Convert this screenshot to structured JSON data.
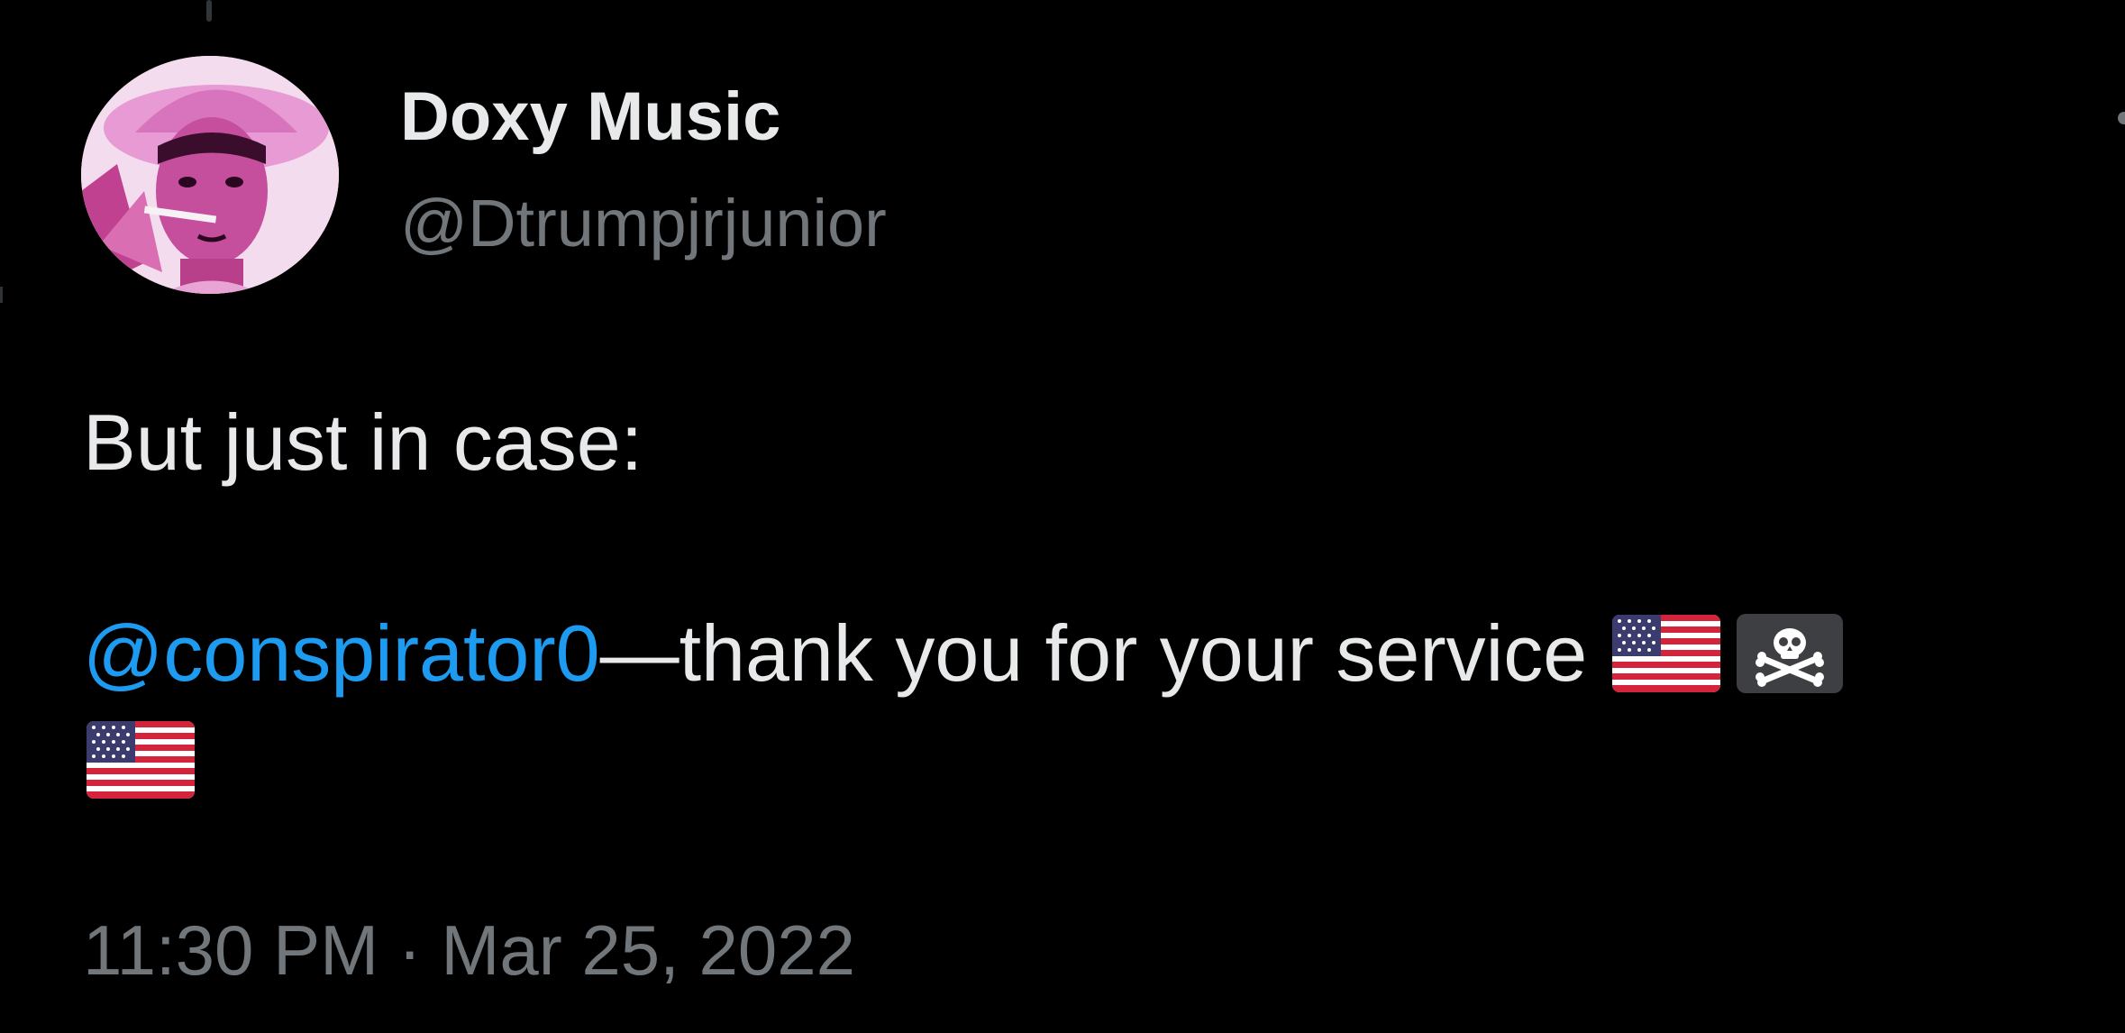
{
  "author": {
    "display_name": "Doxy Music",
    "handle": "@Dtrumpjrjunior"
  },
  "tweet": {
    "line1": "But just in case:",
    "mention": "@conspirator0",
    "line2_text": "—thank you for your service",
    "emoji_sequence": [
      "us-flag-icon",
      "pirate-flag-icon",
      "us-flag-icon"
    ]
  },
  "meta": {
    "time": "11:30 PM",
    "separator": "·",
    "date": "Mar 25, 2022"
  },
  "colors": {
    "background": "#000000",
    "text": "#e7e9ea",
    "muted": "#71767b",
    "link": "#1d9bf0"
  }
}
